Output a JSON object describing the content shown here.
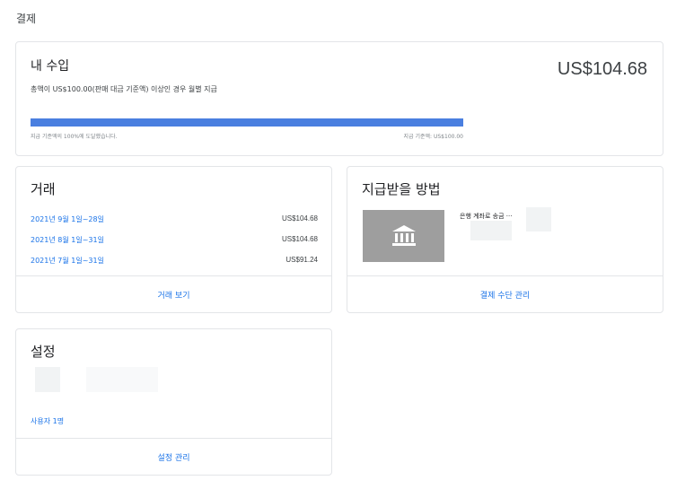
{
  "page": {
    "title": "결제"
  },
  "earnings": {
    "heading": "내 수입",
    "subtitle": "총액이 US$100.00(판매 대금 기준액) 이상인 경우 월별 지급",
    "amount": "US$104.68",
    "progress_fraction": 1.0,
    "progress_left_text": "지급 기준액의 100%에 도달했습니다.",
    "progress_right_text": "지급 기준액: US$100.00",
    "accent_color": "#4a7fe0"
  },
  "transactions": {
    "heading": "거래",
    "rows": [
      {
        "date": "2021년 9월 1일~28일",
        "amount": "US$104.68"
      },
      {
        "date": "2021년 8월 1일~31일",
        "amount": "US$104.68"
      },
      {
        "date": "2021년 7월 1일~31일",
        "amount": "US$91.24"
      }
    ],
    "footer_link": "거래 보기"
  },
  "payment_method": {
    "heading": "지급받을 방법",
    "bank_icon": "bank-icon",
    "bank_label": "은행 계좌로 송금 ···",
    "footer_link": "결제 수단 관리"
  },
  "settings": {
    "heading": "설정",
    "users_link": "사용자 1명",
    "footer_link": "설정 관리"
  },
  "colors": {
    "link": "#1a73e8",
    "border": "#e3e5e8",
    "bank_tile": "#9e9e9e"
  }
}
